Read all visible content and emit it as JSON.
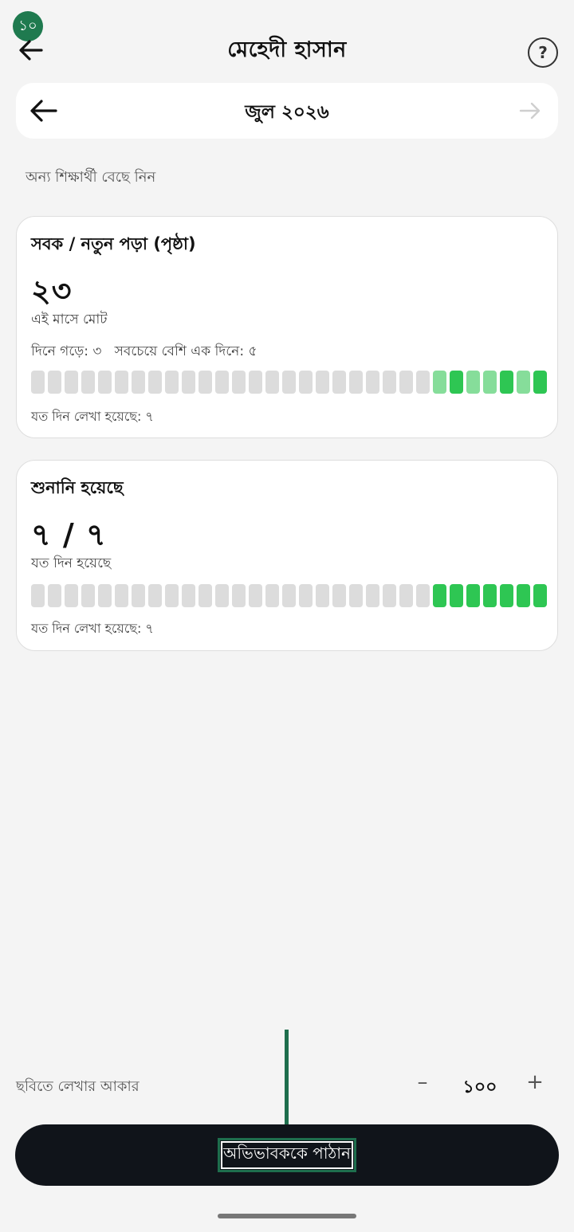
{
  "header": {
    "badge": "১০",
    "title": "মেহেদী হাসান",
    "help_label": "?"
  },
  "month": {
    "label": "জুল ২০২৬"
  },
  "pick_student_label": "অন্য শিক্ষার্থী বেছে নিন",
  "cards": [
    {
      "title": "সবক / নতুন পড়া (পৃষ্ঠা)",
      "value": "২৩",
      "value_caption": "এই মাসে মোট",
      "stats": "দিনে গড়ে: ৩   সবচেয়ে বেশি এক দিনে: ৫",
      "footer": "যত দিন লেখা হয়েছে: ৭",
      "days": [
        0,
        0,
        0,
        0,
        0,
        0,
        0,
        0,
        0,
        0,
        0,
        0,
        0,
        0,
        0,
        0,
        0,
        0,
        0,
        0,
        0,
        0,
        0,
        0,
        1,
        2,
        1,
        1,
        2,
        1,
        2
      ]
    },
    {
      "title": "শুনানি হয়েছে",
      "value": "৭ / ৭",
      "value_caption": "যত দিন হয়েছে",
      "footer": "যত দিন লেখা হয়েছে: ৭",
      "days": [
        0,
        0,
        0,
        0,
        0,
        0,
        0,
        0,
        0,
        0,
        0,
        0,
        0,
        0,
        0,
        0,
        0,
        0,
        0,
        0,
        0,
        0,
        0,
        0,
        2,
        2,
        2,
        2,
        2,
        2,
        2
      ]
    }
  ],
  "text_size": {
    "label": "ছবিতে লেখার আকার",
    "minus": "–",
    "value": "১০০",
    "plus": "+"
  },
  "send_button_label": "অভিভাবককে পাঠান"
}
